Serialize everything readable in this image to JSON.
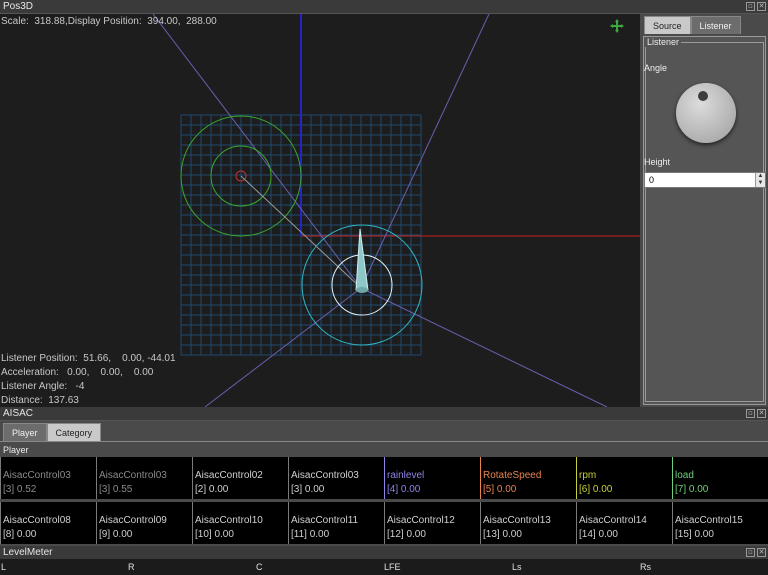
{
  "pos3d": {
    "title": "Pos3D",
    "scale_text": "Scale:  318.88,Display Position:  394.00,  288.00",
    "listener_position": "Listener Position:  51.66,    0.00, -44.01",
    "acceleration": "Acceleration:   0.00,    0.00,    0.00",
    "listener_angle": "Listener Angle:   -4",
    "distance": "Distance:  137.63",
    "move_icon": "move-cross-icon"
  },
  "side": {
    "tabs": [
      {
        "label": "Source"
      },
      {
        "label": "Listener"
      }
    ],
    "group": "Listener",
    "angle_label": "Angle",
    "height_label": "Height",
    "height_value": "0"
  },
  "aisac": {
    "title": "AISAC",
    "tabs": [
      {
        "label": "Player"
      },
      {
        "label": "Category"
      }
    ],
    "group": "Player",
    "row1": [
      {
        "name": "AisacControl03",
        "value": "[3] 0.52",
        "color": "#8a8a8a"
      },
      {
        "name": "AisacControl03",
        "value": "[3] 0.55",
        "color": "#8a8a8a"
      },
      {
        "name": "AisacControl02",
        "value": "[2] 0.00",
        "color": "#d0d0d0"
      },
      {
        "name": "AisacControl03",
        "value": "[3] 0.00",
        "color": "#d0d0d0"
      },
      {
        "name": "rainlevel",
        "value": "[4] 0.00",
        "color": "#8f84e8"
      },
      {
        "name": "RotateSpeed",
        "value": "[5] 0.00",
        "color": "#e8834f"
      },
      {
        "name": "rpm",
        "value": "[6] 0.00",
        "color": "#c8cf3a"
      },
      {
        "name": "load",
        "value": "[7] 0.00",
        "color": "#6fcf7a"
      }
    ],
    "row2": [
      {
        "name": "AisacControl08",
        "value": "[8] 0.00"
      },
      {
        "name": "AisacControl09",
        "value": "[9] 0.00"
      },
      {
        "name": "AisacControl10",
        "value": "[10] 0.00"
      },
      {
        "name": "AisacControl11",
        "value": "[11] 0.00"
      },
      {
        "name": "AisacControl12",
        "value": "[12] 0.00"
      },
      {
        "name": "AisacControl13",
        "value": "[13] 0.00"
      },
      {
        "name": "AisacControl14",
        "value": "[14] 0.00"
      },
      {
        "name": "AisacControl15",
        "value": "[15] 0.00"
      }
    ]
  },
  "levelmeter": {
    "title": "LevelMeter",
    "channels": [
      "L",
      "R",
      "C",
      "LFE",
      "Ls",
      "Rs"
    ]
  },
  "window_buttons": [
    "restore-icon",
    "close-icon"
  ]
}
